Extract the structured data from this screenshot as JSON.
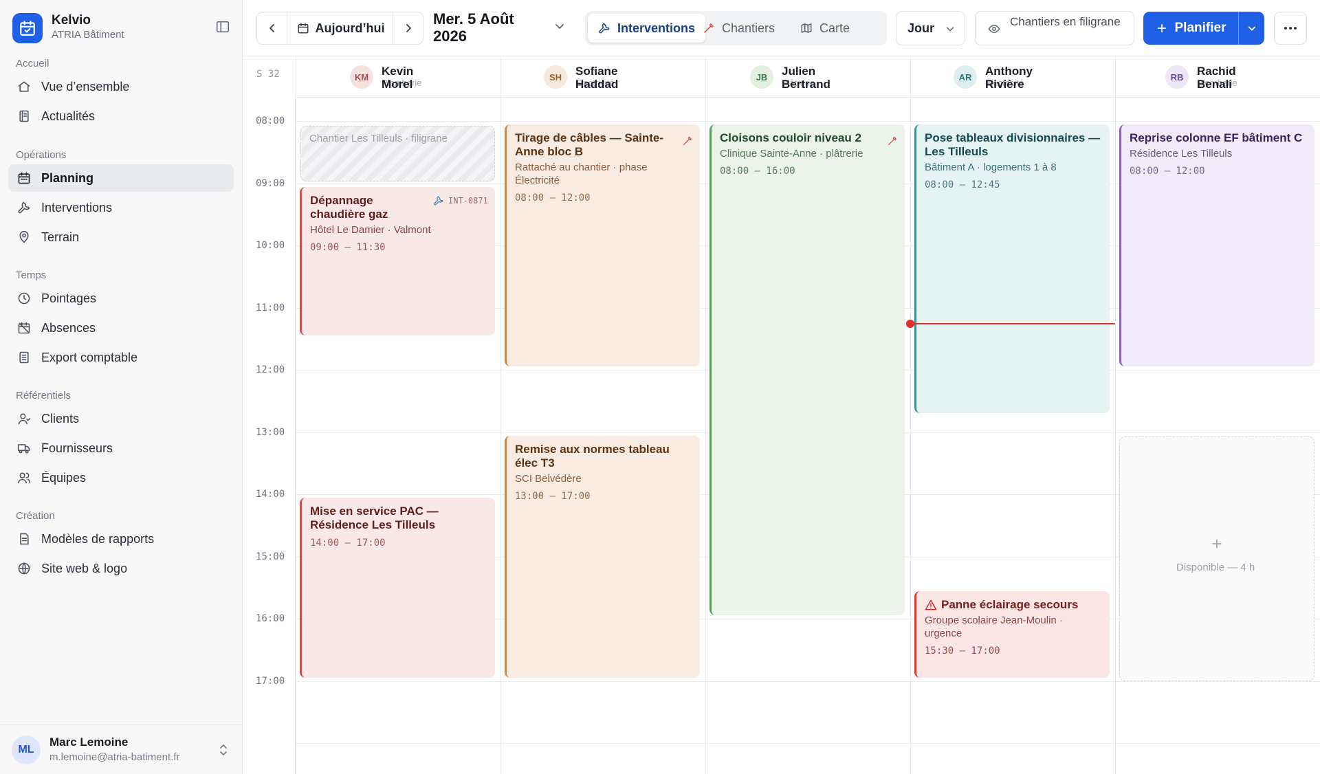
{
  "app": {
    "name": "Kelvio",
    "company": "ATRIA Bâtiment"
  },
  "sidebar": {
    "sections": [
      {
        "title": "Accueil",
        "items": [
          {
            "label": "Vue d’ensemble",
            "icon": "home-icon"
          },
          {
            "label": "Actualités",
            "icon": "news-icon"
          }
        ]
      },
      {
        "title": "Opérations",
        "items": [
          {
            "label": "Planning",
            "icon": "calendar-icon",
            "active": true
          },
          {
            "label": "Interventions",
            "icon": "wrench-icon"
          },
          {
            "label": "Terrain",
            "icon": "map-pin-icon"
          }
        ]
      },
      {
        "title": "Temps",
        "items": [
          {
            "label": "Pointages",
            "icon": "clock-icon"
          },
          {
            "label": "Absences",
            "icon": "calendar-off-icon"
          },
          {
            "label": "Export comptable",
            "icon": "spreadsheet-icon"
          }
        ]
      },
      {
        "title": "Référentiels",
        "items": [
          {
            "label": "Clients",
            "icon": "user-icon"
          },
          {
            "label": "Fournisseurs",
            "icon": "truck-icon"
          },
          {
            "label": "Équipes",
            "icon": "users-icon"
          }
        ]
      },
      {
        "title": "Création",
        "items": [
          {
            "label": "Modèles de rapports",
            "icon": "file-text-icon"
          },
          {
            "label": "Site web & logo",
            "icon": "globe-icon"
          }
        ]
      }
    ],
    "user": {
      "initials": "ML",
      "name": "Marc Lemoine",
      "email": "m.lemoine@atria-batiment.fr"
    }
  },
  "toolbar": {
    "today_label": "Aujourd’hui",
    "date_line1": "Mer. 5 Août",
    "date_line2": "2026",
    "tabs": [
      {
        "label": "Interventions",
        "icon": "wrench-icon",
        "active": true
      },
      {
        "label": "Chantiers",
        "icon": "hammer-icon"
      },
      {
        "label": "Carte",
        "icon": "map-icon"
      }
    ],
    "view_label": "Jour",
    "watermark_label": "Chantiers en filigrane",
    "plan_label": "Planifier"
  },
  "planning": {
    "week_label": "S 32",
    "hours": [
      "08:00",
      "09:00",
      "10:00",
      "11:00",
      "12:00",
      "13:00",
      "14:00",
      "15:00",
      "16:00",
      "17:00"
    ],
    "resources": [
      {
        "initials": "KM",
        "first": "Kevin",
        "last": "Morel",
        "role": "Plomberie",
        "avatar_bg": "#f6e3e1",
        "avatar_fg": "#a44a44"
      },
      {
        "initials": "SH",
        "first": "Sofiane",
        "last": "Haddad",
        "role": "Électricité",
        "avatar_bg": "#f6e9dd",
        "avatar_fg": "#9b6232"
      },
      {
        "initials": "JB",
        "first": "Julien",
        "last": "Bertrand",
        "role": "Plâtrerie",
        "avatar_bg": "#e3efe1",
        "avatar_fg": "#3f7a46"
      },
      {
        "initials": "AR",
        "first": "Anthony",
        "last": "Rivière",
        "role": "Électricité",
        "avatar_bg": "#dfeeee",
        "avatar_fg": "#2d747c"
      },
      {
        "initials": "RB",
        "first": "Rachid",
        "last": "Benali",
        "role": "Plomberie",
        "avatar_bg": "#ece6f5",
        "avatar_fg": "#6a4d95"
      }
    ],
    "watermark_event": {
      "label": "Chantier Les Tilleuls · filigrane"
    },
    "events": [
      {
        "col": 0,
        "start": "09:00",
        "end": "11:30",
        "style": "red",
        "title": "Dépannage chaudière gaz",
        "subtitle": "Hôtel Le Damier · Valmont",
        "time": "09:00 – 11:30",
        "ref": "INT-0871",
        "icon": "wrench-icon"
      },
      {
        "col": 0,
        "start": "14:00",
        "end": "17:00",
        "style": "red",
        "title": "Mise en service PAC — Résidence Les Tilleuls",
        "subtitle": "",
        "time": "14:00 – 17:00"
      },
      {
        "col": 1,
        "start": "08:00",
        "end": "12:00",
        "style": "orange",
        "title": "Tirage de câbles — Sainte-Anne bloc B",
        "subtitle": "Rattaché au chantier · phase Électricité",
        "time": "08:00 – 12:00",
        "icon": "hammer-icon"
      },
      {
        "col": 1,
        "start": "13:00",
        "end": "17:00",
        "style": "orange",
        "title": "Remise aux normes tableau élec T3",
        "subtitle": "SCI Belvédère",
        "time": "13:00 – 17:00"
      },
      {
        "col": 2,
        "start": "08:00",
        "end": "16:00",
        "style": "green",
        "title": "Cloisons couloir niveau 2",
        "subtitle": "Clinique Sainte-Anne · plâtrerie",
        "time": "08:00 – 16:00",
        "icon": "hammer-icon"
      },
      {
        "col": 3,
        "start": "08:00",
        "end": "12:45",
        "style": "teal",
        "title": "Pose tableaux divisionnaires — Les Tilleuls",
        "subtitle": "Bâtiment A · logements 1 à 8",
        "time": "08:00 – 12:45"
      },
      {
        "col": 3,
        "start": "15:30",
        "end": "17:00",
        "style": "urgent",
        "title": "Panne éclairage secours",
        "subtitle": "Groupe scolaire Jean-Moulin · urgence",
        "time": "15:30 – 17:00",
        "icon": "warning-icon"
      },
      {
        "col": 4,
        "start": "08:00",
        "end": "12:00",
        "style": "purple",
        "title": "Reprise colonne EF bâtiment C",
        "subtitle": "Résidence Les Tilleuls",
        "time": "08:00 – 12:00"
      }
    ],
    "available_slot": {
      "col": 4,
      "start": "13:00",
      "end": "17:00",
      "label": "Disponible — 4 h"
    },
    "now_time": "11:15"
  }
}
